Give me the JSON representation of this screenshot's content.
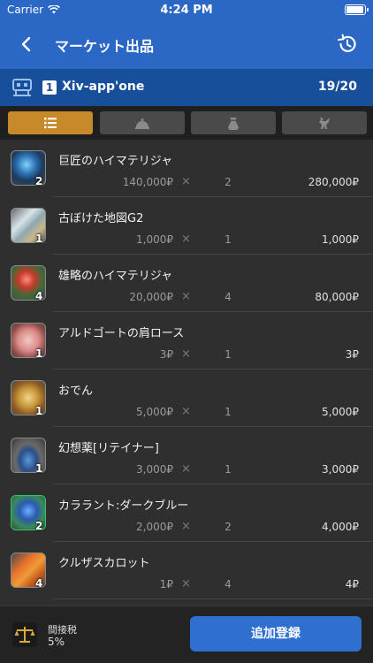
{
  "status": {
    "carrier": "Carrier",
    "time": "4:24 PM"
  },
  "nav": {
    "title": "マーケット出品"
  },
  "retainer": {
    "index": "1",
    "name": "Xiv-app'one",
    "count": "19/20"
  },
  "tabs": [
    {
      "name": "list",
      "active": true
    },
    {
      "name": "bell"
    },
    {
      "name": "bag"
    },
    {
      "name": "chocobo"
    }
  ],
  "items": [
    {
      "name": "巨匠のハイマテリジャ",
      "qty": "2",
      "price": "140,000",
      "quantity": "2",
      "total": "280,000",
      "icon": "materia-blue"
    },
    {
      "name": "古ぼけた地図G2",
      "qty": "1",
      "price": "1,000",
      "quantity": "1",
      "total": "1,000",
      "icon": "map-bottle"
    },
    {
      "name": "雄略のハイマテリジャ",
      "qty": "4",
      "price": "20,000",
      "quantity": "4",
      "total": "80,000",
      "icon": "materia-red"
    },
    {
      "name": "アルドゴートの肩ロース",
      "qty": "1",
      "price": "3",
      "quantity": "1",
      "total": "3",
      "icon": "meat"
    },
    {
      "name": "おでん",
      "qty": "1",
      "price": "5,000",
      "quantity": "1",
      "total": "5,000",
      "icon": "oden"
    },
    {
      "name": "幻想薬[リテイナー]",
      "qty": "1",
      "price": "3,000",
      "quantity": "1",
      "total": "3,000",
      "icon": "potion"
    },
    {
      "name": "カララント:ダークブルー",
      "qty": "2",
      "price": "2,000",
      "quantity": "2",
      "total": "4,000",
      "icon": "dye"
    },
    {
      "name": "クルザスカロット",
      "qty": "4",
      "price": "1",
      "quantity": "4",
      "total": "4",
      "icon": "carrot"
    }
  ],
  "currency": "₽",
  "times_symbol": "×",
  "footer": {
    "tax_label": "間接税",
    "tax_value": "5%",
    "add_button": "追加登録"
  },
  "colors": {
    "accent": "#2b68c5",
    "retainer_bar": "#184f9a",
    "active_tab": "#c68a2a"
  }
}
